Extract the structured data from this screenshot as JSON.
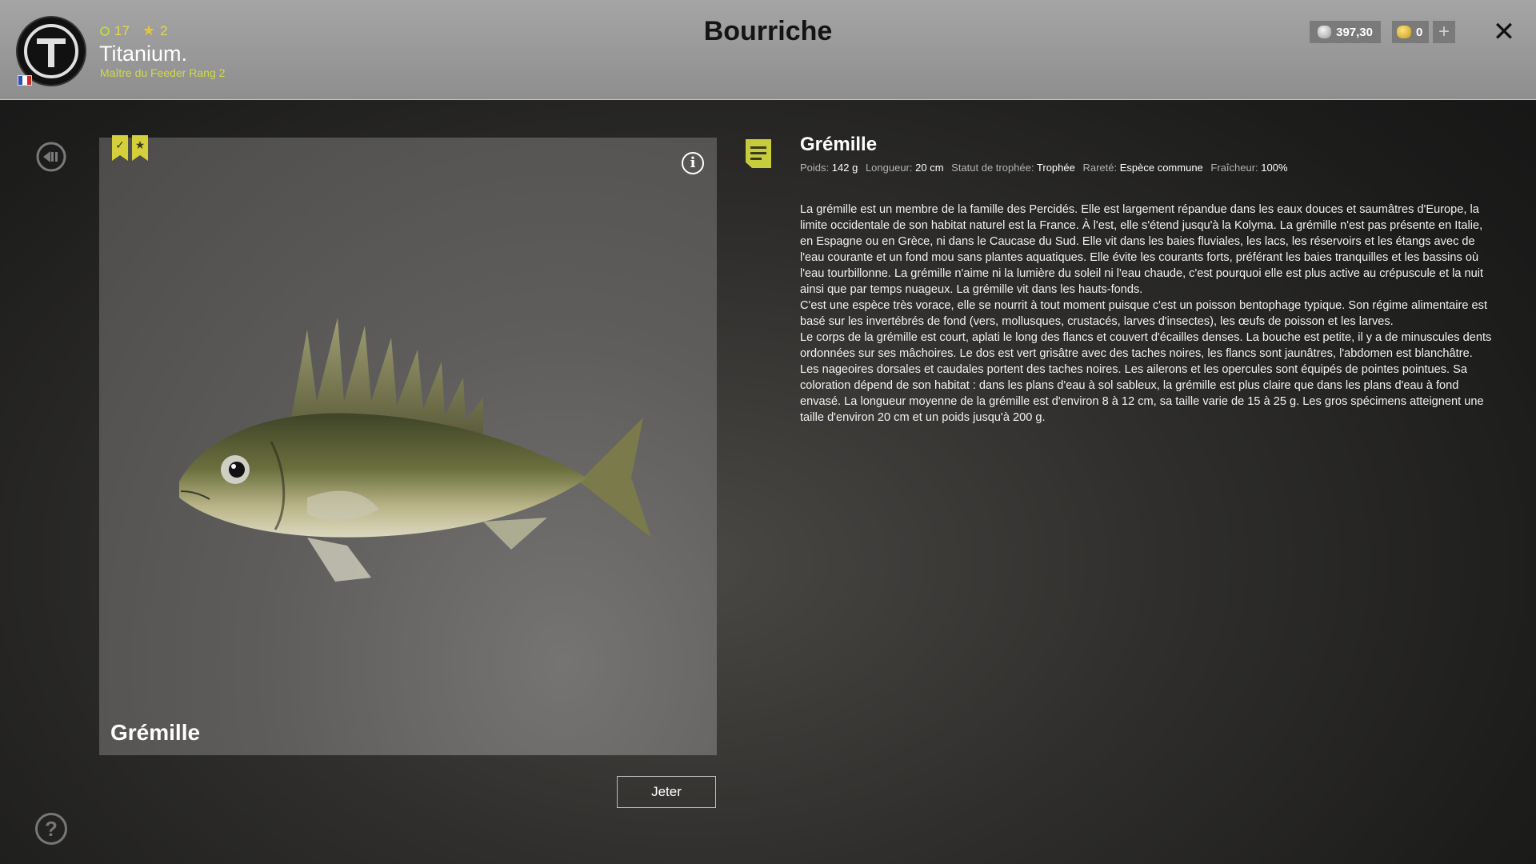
{
  "header": {
    "title": "Bourriche",
    "player": {
      "name": "Titanium.",
      "rank": "Maître du Feeder Rang 2",
      "level": "17",
      "stars": "2",
      "flag_colors": [
        "#2a4fb8",
        "#ffffff",
        "#d02a2a"
      ]
    },
    "currency": {
      "silver": "397,30",
      "gold": "0",
      "silver_icon": "silver-coin-icon",
      "gold_icon": "gold-coin-icon"
    },
    "add_funds_symbol": "+",
    "close_symbol": "✕"
  },
  "sidebar": {
    "back_icon": "back-arrow-icon",
    "help_symbol": "?"
  },
  "fish_card": {
    "name": "Grémille",
    "badges": [
      "check-badge-icon",
      "star-badge-icon"
    ],
    "badge_check_symbol": "✓",
    "badge_star_symbol": "★",
    "info_symbol": "i"
  },
  "actions": {
    "discard_label": "Jeter"
  },
  "details": {
    "title": "Grémille",
    "meta": [
      {
        "label": "Poids:",
        "value": "142 g"
      },
      {
        "label": "Longueur:",
        "value": "20 cm"
      },
      {
        "label": "Statut de trophée:",
        "value": "Trophée"
      },
      {
        "label": "Rareté:",
        "value": "Espèce commune"
      },
      {
        "label": "Fraîcheur:",
        "value": "100%"
      }
    ],
    "description": [
      "La grémille est un membre de la famille des Percidés. Elle est largement répandue dans les eaux douces et saumâtres d'Europe, la limite occidentale de son habitat naturel est la France. À l'est, elle s'étend jusqu'à la Kolyma. La grémille n'est pas présente en Italie, en Espagne ou en Grèce, ni dans le Caucase du Sud. Elle vit dans les baies fluviales, les lacs, les réservoirs et les étangs avec de l'eau courante et un fond mou sans plantes aquatiques. Elle évite les courants forts, préférant les baies tranquilles et les bassins où l'eau tourbillonne. La grémille n'aime ni la lumière du soleil ni l'eau chaude, c'est pourquoi elle est plus active au crépuscule et la nuit ainsi que par temps nuageux. La grémille vit dans les hauts-fonds.",
      "C'est une espèce très vorace, elle se nourrit à tout moment puisque c'est un poisson bentophage typique. Son régime alimentaire est basé sur les invertébrés de fond (vers, mollusques, crustacés, larves d'insectes), les œufs de poisson et les larves.",
      "Le corps de la grémille est court, aplati le long des flancs et couvert d'écailles denses. La bouche est petite, il y a de minuscules dents ordonnées sur ses mâchoires. Le dos est vert grisâtre avec des taches noires, les flancs sont jaunâtres, l'abdomen est blanchâtre. Les nageoires dorsales et caudales portent des taches noires. Les ailerons et les opercules sont équipés de pointes pointues. Sa coloration dépend de son habitat : dans les plans d'eau à sol sableux, la grémille est plus claire que dans les plans d'eau à fond envasé. La longueur moyenne de la grémille est d'environ 8 à 12 cm, sa taille varie de 15 à 25 g. Les gros spécimens atteignent une taille d'environ 20 cm et un poids jusqu'à 200 g."
    ]
  },
  "colors": {
    "accent": "#cfd84a",
    "badge": "#d6cf3c",
    "header_bg": "#9a9a9a"
  }
}
